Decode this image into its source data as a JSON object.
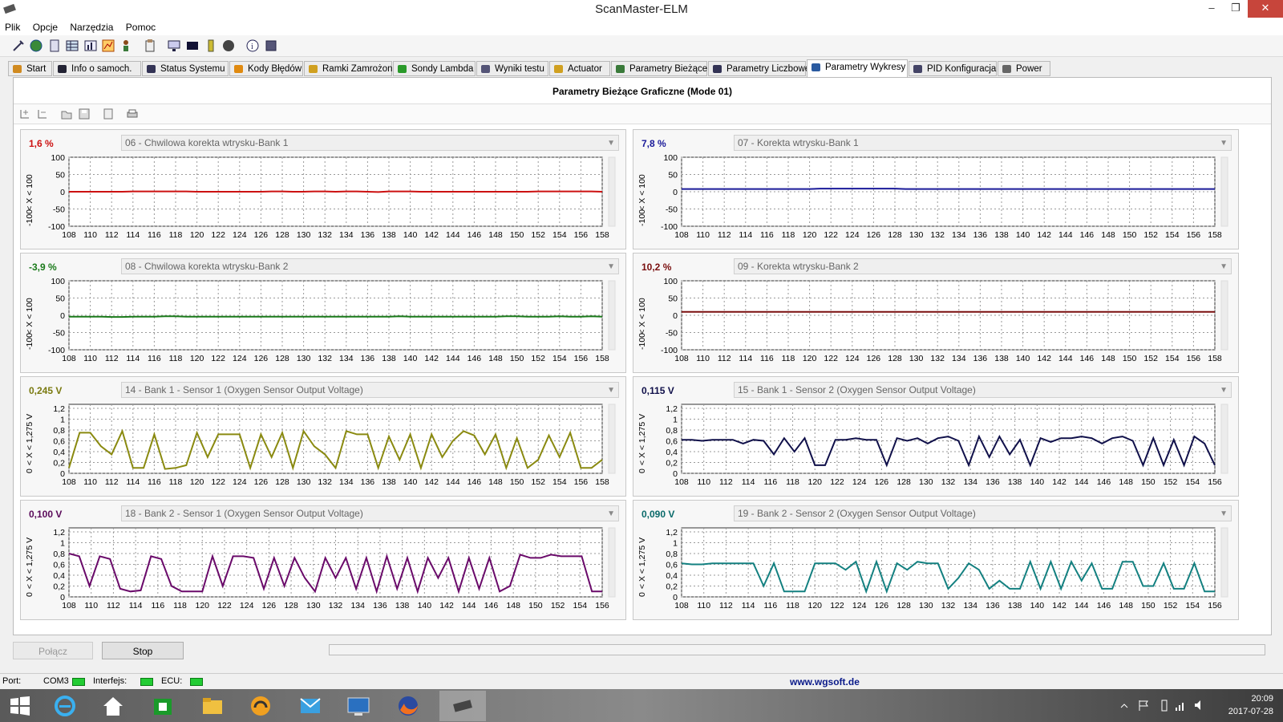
{
  "window": {
    "title": "ScanMaster-ELM"
  },
  "window_controls": {
    "minimize": "–",
    "maximize": "❐",
    "close": "✕"
  },
  "menu": [
    "Plik",
    "Opcje",
    "Narzędzia",
    "Pomoc"
  ],
  "tabs": [
    {
      "label": "Start",
      "icon": "start-icon"
    },
    {
      "label": "Info o samoch.",
      "icon": "info-icon"
    },
    {
      "label": "Status Systemu",
      "icon": "status-icon"
    },
    {
      "label": "Kody Błędów",
      "icon": "warning-icon"
    },
    {
      "label": "Ramki Zamrożone",
      "icon": "freeze-icon"
    },
    {
      "label": "Sondy Lambda",
      "icon": "lambda-icon"
    },
    {
      "label": "Wyniki testu",
      "icon": "gear-icon"
    },
    {
      "label": "Actuator",
      "icon": "actuator-icon"
    },
    {
      "label": "Parametry Bieżące",
      "icon": "list-icon"
    },
    {
      "label": "Parametry Liczbowe",
      "icon": "table-icon"
    },
    {
      "label": "Parametry Wykresy",
      "icon": "chart-icon",
      "active": true
    },
    {
      "label": "PID Konfiguracja",
      "icon": "config-icon"
    },
    {
      "label": "Power",
      "icon": "power-icon"
    }
  ],
  "panel": {
    "title": "Parametry Bieżące Graficzne (Mode 01)"
  },
  "charts": [
    {
      "value": "1,6 %",
      "value_color": "#cc1111",
      "pid": "06 - Chwilowa korekta wtrysku-Bank 1",
      "line_color": "#cc1111",
      "ylabel": "< X < 100",
      "yticks": [
        "100",
        "50",
        "0",
        "-50",
        "-100"
      ],
      "ylabel_bottom": "-100",
      "xticks": [
        "108",
        "110",
        "112",
        "114",
        "116",
        "118",
        "120",
        "122",
        "124",
        "126",
        "128",
        "130",
        "132",
        "134",
        "136",
        "138",
        "140",
        "142",
        "144",
        "146",
        "148",
        "150",
        "152",
        "154",
        "156",
        "158"
      ],
      "ymin": -100,
      "ymax": 100,
      "series": [
        0,
        0,
        0,
        0,
        0,
        0,
        1,
        1,
        1,
        1,
        1,
        1,
        0,
        0,
        0,
        0,
        0,
        0,
        0,
        1,
        1,
        0,
        0,
        1,
        1,
        0,
        1,
        1,
        0,
        -1,
        1,
        1,
        1,
        0,
        0,
        0,
        0,
        0,
        0,
        0,
        0,
        0,
        0,
        0,
        1,
        1,
        1,
        1,
        1,
        1,
        0
      ]
    },
    {
      "value": "7,8 %",
      "value_color": "#1a1a99",
      "pid": "07 - Korekta wtrysku-Bank 1",
      "line_color": "#1a1a99",
      "ylabel": "< X < 100",
      "yticks": [
        "100",
        "50",
        "0",
        "-50",
        "-100"
      ],
      "ylabel_bottom": "-100",
      "xticks": [
        "108",
        "110",
        "112",
        "114",
        "116",
        "118",
        "120",
        "122",
        "124",
        "126",
        "128",
        "130",
        "132",
        "134",
        "136",
        "138",
        "140",
        "142",
        "144",
        "146",
        "148",
        "150",
        "152",
        "154",
        "156",
        "158"
      ],
      "ymin": -100,
      "ymax": 100,
      "series": [
        8,
        8,
        8,
        8,
        8,
        8,
        8,
        8,
        8,
        8,
        8,
        8,
        8,
        9,
        9,
        9,
        9,
        9,
        9,
        9,
        9,
        8,
        8,
        8,
        8,
        8,
        8,
        8,
        8,
        8,
        8,
        8,
        8,
        8,
        8,
        8,
        8,
        8,
        8,
        8,
        8,
        8,
        8,
        8,
        8,
        8,
        8,
        8,
        8,
        8,
        8
      ]
    },
    {
      "value": "-3,9 %",
      "value_color": "#1a7a1a",
      "pid": "08 - Chwilowa korekta wtrysku-Bank 2",
      "line_color": "#1a7a1a",
      "ylabel": "< X < 100",
      "yticks": [
        "100",
        "50",
        "0",
        "-50",
        "-100"
      ],
      "ylabel_bottom": "-100",
      "xticks": [
        "108",
        "110",
        "112",
        "114",
        "116",
        "118",
        "120",
        "122",
        "124",
        "126",
        "128",
        "130",
        "132",
        "134",
        "136",
        "138",
        "140",
        "142",
        "144",
        "146",
        "148",
        "150",
        "152",
        "154",
        "156",
        "158"
      ],
      "ymin": -100,
      "ymax": 100,
      "series": [
        -4,
        -4,
        -4,
        -4,
        -5,
        -5,
        -4,
        -4,
        -4,
        -3,
        -3,
        -4,
        -4,
        -4,
        -4,
        -4,
        -4,
        -4,
        -4,
        -4,
        -4,
        -4,
        -4,
        -4,
        -4,
        -4,
        -4,
        -4,
        -4,
        -4,
        -4,
        -3,
        -4,
        -4,
        -4,
        -4,
        -4,
        -4,
        -4,
        -4,
        -4,
        -3,
        -3,
        -4,
        -4,
        -4,
        -3,
        -4,
        -4,
        -3,
        -4
      ]
    },
    {
      "value": "10,2 %",
      "value_color": "#7a0f0f",
      "pid": "09 - Korekta wtrysku-Bank 2",
      "line_color": "#7a0f0f",
      "ylabel": "< X < 100",
      "yticks": [
        "100",
        "50",
        "0",
        "-50",
        "-100"
      ],
      "ylabel_bottom": "-100",
      "xticks": [
        "108",
        "110",
        "112",
        "114",
        "116",
        "118",
        "120",
        "122",
        "124",
        "126",
        "128",
        "130",
        "132",
        "134",
        "136",
        "138",
        "140",
        "142",
        "144",
        "146",
        "148",
        "150",
        "152",
        "154",
        "156",
        "158"
      ],
      "ymin": -100,
      "ymax": 100,
      "series": [
        10,
        10,
        10,
        10,
        10,
        10,
        10,
        10,
        10,
        10,
        10,
        10,
        10,
        10,
        10,
        10,
        10,
        10,
        10,
        10,
        10,
        10,
        10,
        10,
        10,
        10,
        10,
        10,
        10,
        10,
        10,
        10,
        10,
        10,
        10,
        10,
        10,
        10,
        10,
        10,
        10,
        10,
        10,
        10,
        10,
        10,
        10,
        10,
        10,
        10,
        10
      ]
    },
    {
      "value": "0,245 V",
      "value_color": "#7a7a10",
      "pid": "14 - Bank 1 - Sensor 1 (Oxygen Sensor Output Voltage)",
      "line_color": "#8a8a10",
      "ylabel": "< X < 1,275 V",
      "yticks": [
        "1,2",
        "1",
        "0,8",
        "0,6",
        "0,4",
        "0,2",
        "0"
      ],
      "ylabel_bottom": "0",
      "xticks": [
        "108",
        "110",
        "112",
        "114",
        "116",
        "118",
        "120",
        "122",
        "124",
        "126",
        "128",
        "130",
        "132",
        "134",
        "136",
        "138",
        "140",
        "142",
        "144",
        "146",
        "148",
        "150",
        "152",
        "154",
        "156",
        "158"
      ],
      "ymin": 0,
      "ymax": 1.275,
      "series": [
        0.1,
        0.75,
        0.75,
        0.5,
        0.35,
        0.78,
        0.1,
        0.1,
        0.72,
        0.08,
        0.1,
        0.15,
        0.75,
        0.3,
        0.72,
        0.72,
        0.72,
        0.1,
        0.72,
        0.3,
        0.75,
        0.1,
        0.78,
        0.5,
        0.35,
        0.1,
        0.78,
        0.72,
        0.72,
        0.1,
        0.68,
        0.25,
        0.72,
        0.1,
        0.72,
        0.3,
        0.6,
        0.78,
        0.7,
        0.35,
        0.72,
        0.1,
        0.65,
        0.1,
        0.25,
        0.7,
        0.3,
        0.75,
        0.1,
        0.1,
        0.25
      ]
    },
    {
      "value": "0,115 V",
      "value_color": "#10104a",
      "pid": "15 - Bank 1 - Sensor 2 (Oxygen Sensor Output Voltage)",
      "line_color": "#10104a",
      "ylabel": "< X < 1,275 V",
      "yticks": [
        "1,2",
        "1",
        "0,8",
        "0,6",
        "0,4",
        "0,2",
        "0"
      ],
      "ylabel_bottom": "0",
      "xticks": [
        "108",
        "110",
        "112",
        "114",
        "116",
        "118",
        "120",
        "122",
        "124",
        "126",
        "128",
        "130",
        "132",
        "134",
        "136",
        "138",
        "140",
        "142",
        "144",
        "146",
        "148",
        "150",
        "152",
        "154",
        "156"
      ],
      "ymin": 0,
      "ymax": 1.275,
      "series": [
        0.62,
        0.62,
        0.6,
        0.62,
        0.62,
        0.62,
        0.55,
        0.62,
        0.6,
        0.35,
        0.65,
        0.4,
        0.65,
        0.15,
        0.15,
        0.62,
        0.62,
        0.65,
        0.62,
        0.62,
        0.15,
        0.65,
        0.6,
        0.65,
        0.55,
        0.65,
        0.68,
        0.6,
        0.15,
        0.68,
        0.3,
        0.68,
        0.35,
        0.62,
        0.15,
        0.65,
        0.58,
        0.65,
        0.65,
        0.68,
        0.65,
        0.55,
        0.65,
        0.68,
        0.6,
        0.15,
        0.65,
        0.15,
        0.62,
        0.15,
        0.68,
        0.55,
        0.15
      ]
    },
    {
      "value": "0,100 V",
      "value_color": "#5a0a5a",
      "pid": "18 - Bank 2 - Sensor 1 (Oxygen Sensor Output Voltage)",
      "line_color": "#6a0a6a",
      "ylabel": "< X < 1,275 V",
      "yticks": [
        "1,2",
        "1",
        "0,8",
        "0,6",
        "0,4",
        "0,2",
        "0"
      ],
      "ylabel_bottom": "0",
      "xticks": [
        "108",
        "110",
        "112",
        "114",
        "116",
        "118",
        "120",
        "122",
        "124",
        "126",
        "128",
        "130",
        "132",
        "134",
        "136",
        "138",
        "140",
        "142",
        "144",
        "146",
        "148",
        "150",
        "152",
        "154",
        "156"
      ],
      "ymin": 0,
      "ymax": 1.275,
      "series": [
        0.8,
        0.75,
        0.2,
        0.75,
        0.7,
        0.15,
        0.1,
        0.12,
        0.75,
        0.7,
        0.2,
        0.1,
        0.1,
        0.1,
        0.75,
        0.2,
        0.75,
        0.75,
        0.72,
        0.15,
        0.72,
        0.2,
        0.72,
        0.35,
        0.1,
        0.72,
        0.35,
        0.72,
        0.15,
        0.72,
        0.1,
        0.75,
        0.15,
        0.72,
        0.1,
        0.72,
        0.35,
        0.72,
        0.1,
        0.72,
        0.15,
        0.72,
        0.1,
        0.2,
        0.78,
        0.72,
        0.72,
        0.78,
        0.75,
        0.75,
        0.75,
        0.1,
        0.1
      ]
    },
    {
      "value": "0,090 V",
      "value_color": "#0a6a6a",
      "pid": "19 - Bank 2 - Sensor 2 (Oxygen Sensor Output Voltage)",
      "line_color": "#138080",
      "ylabel": "< X < 1,275 V",
      "yticks": [
        "1,2",
        "1",
        "0,8",
        "0,6",
        "0,4",
        "0,2",
        "0"
      ],
      "ylabel_bottom": "0",
      "xticks": [
        "108",
        "110",
        "112",
        "114",
        "116",
        "118",
        "120",
        "122",
        "124",
        "126",
        "128",
        "130",
        "132",
        "134",
        "136",
        "138",
        "140",
        "142",
        "144",
        "146",
        "148",
        "150",
        "152",
        "154",
        "156"
      ],
      "ymin": 0,
      "ymax": 1.275,
      "series": [
        0.62,
        0.6,
        0.6,
        0.62,
        0.62,
        0.62,
        0.62,
        0.62,
        0.2,
        0.62,
        0.1,
        0.1,
        0.1,
        0.62,
        0.62,
        0.62,
        0.5,
        0.65,
        0.1,
        0.65,
        0.1,
        0.62,
        0.5,
        0.65,
        0.62,
        0.62,
        0.15,
        0.35,
        0.62,
        0.5,
        0.15,
        0.3,
        0.15,
        0.15,
        0.65,
        0.15,
        0.65,
        0.15,
        0.65,
        0.3,
        0.62,
        0.15,
        0.15,
        0.65,
        0.65,
        0.2,
        0.2,
        0.62,
        0.15,
        0.15,
        0.62,
        0.1,
        0.1
      ]
    }
  ],
  "controls": {
    "connect": "Połącz",
    "stop": "Stop"
  },
  "status": {
    "port_label": "Port:",
    "port_value": "COM3",
    "interface_label": "Interfejs:",
    "ecu_label": "ECU:",
    "link": "www.wgsoft.de"
  },
  "taskbar": {
    "time": "20:09",
    "date": "2017-07-28"
  }
}
